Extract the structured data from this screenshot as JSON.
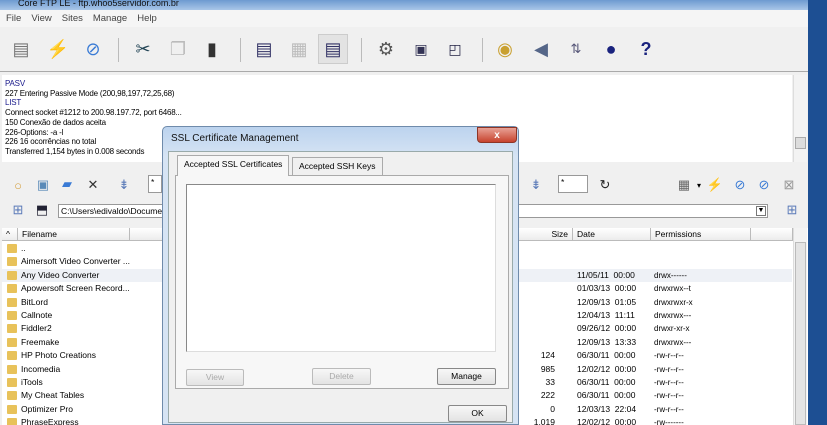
{
  "window": {
    "title": "Core FTP LE - ftp.whoo5servidor.com.br"
  },
  "menu": [
    "File",
    "View",
    "Sites",
    "Manage",
    "Help"
  ],
  "toolbar": {
    "icons": [
      "site-manager-icon",
      "quick-connect-icon",
      "connect-icon",
      "cut-icon",
      "copy-icon",
      "paste-icon",
      "view-text-icon",
      "view-hex-icon",
      "view-mixed-icon",
      "settings-icon",
      "script-icon",
      "terminal-icon",
      "view-icon",
      "sound-icon",
      "transfer-icon",
      "status-icon",
      "help-icon"
    ]
  },
  "log": [
    {
      "text": "PASV",
      "cmd": true
    },
    {
      "text": "227 Entering Passive Mode (200,98,197,72,25,68)",
      "cmd": false
    },
    {
      "text": "LIST",
      "cmd": true
    },
    {
      "text": "Connect socket #1212 to 200.98.197.72, port 6468...",
      "cmd": false
    },
    {
      "text": "150 Conexão de dados aceita",
      "cmd": false
    },
    {
      "text": "226-Options: -a -l",
      "cmd": false
    },
    {
      "text": "226 16 ocorrências no total",
      "cmd": false
    },
    {
      "text": "Transferred 1,154 bytes in 0.008 seconds",
      "cmd": false
    }
  ],
  "pane": {
    "filter_left": "*",
    "filter_right": "*",
    "path": "C:\\Users\\edivaldo\\Docume",
    "columns": {
      "filename": "Filename",
      "size": "Size",
      "date": "Date",
      "permissions": "Permissions"
    },
    "files": [
      {
        "name": "..",
        "size": "",
        "date": "",
        "perm": ""
      },
      {
        "name": "Aimersoft Video Converter ...",
        "size": "",
        "date": "",
        "perm": ""
      },
      {
        "name": "Any Video Converter",
        "size": "",
        "date": "11/05/11  00:00",
        "perm": "drwx------"
      },
      {
        "name": "Apowersoft Screen Record...",
        "size": "",
        "date": "01/03/13  00:00",
        "perm": "drwxrwx--t"
      },
      {
        "name": "BitLord",
        "size": "",
        "date": "12/09/13  01:05",
        "perm": "drwxrwxr-x"
      },
      {
        "name": "Callnote",
        "size": "",
        "date": "12/04/13  11:11",
        "perm": "drwxrwx---"
      },
      {
        "name": "Fiddler2",
        "size": "",
        "date": "09/26/12  00:00",
        "perm": "drwxr-xr-x"
      },
      {
        "name": "Freemake",
        "size": "",
        "date": "12/09/13  13:33",
        "perm": "drwxrwx---"
      },
      {
        "name": "HP Photo Creations",
        "size": "124",
        "date": "06/30/11  00:00",
        "perm": "-rw-r--r--"
      },
      {
        "name": "Incomedia",
        "size": "985",
        "date": "12/02/12  00:00",
        "perm": "-rw-r--r--"
      },
      {
        "name": "iTools",
        "size": "33",
        "date": "06/30/11  00:00",
        "perm": "-rw-r--r--"
      },
      {
        "name": "My Cheat Tables",
        "size": "222",
        "date": "06/30/11  00:00",
        "perm": "-rw-r--r--"
      },
      {
        "name": "Optimizer Pro",
        "size": "0",
        "date": "12/03/13  22:04",
        "perm": "-rw-r--r--"
      },
      {
        "name": "PhraseExpress",
        "size": "1,019",
        "date": "12/02/12  00:00",
        "perm": "-rw-------"
      }
    ]
  },
  "dialog": {
    "title": "SSL Certificate Management",
    "close": "x",
    "tabs": [
      "Accepted SSL Certificates",
      "Accepted SSH Keys"
    ],
    "buttons": {
      "view": "View",
      "delete": "Delete",
      "manage": "Manage",
      "ok": "OK"
    }
  }
}
